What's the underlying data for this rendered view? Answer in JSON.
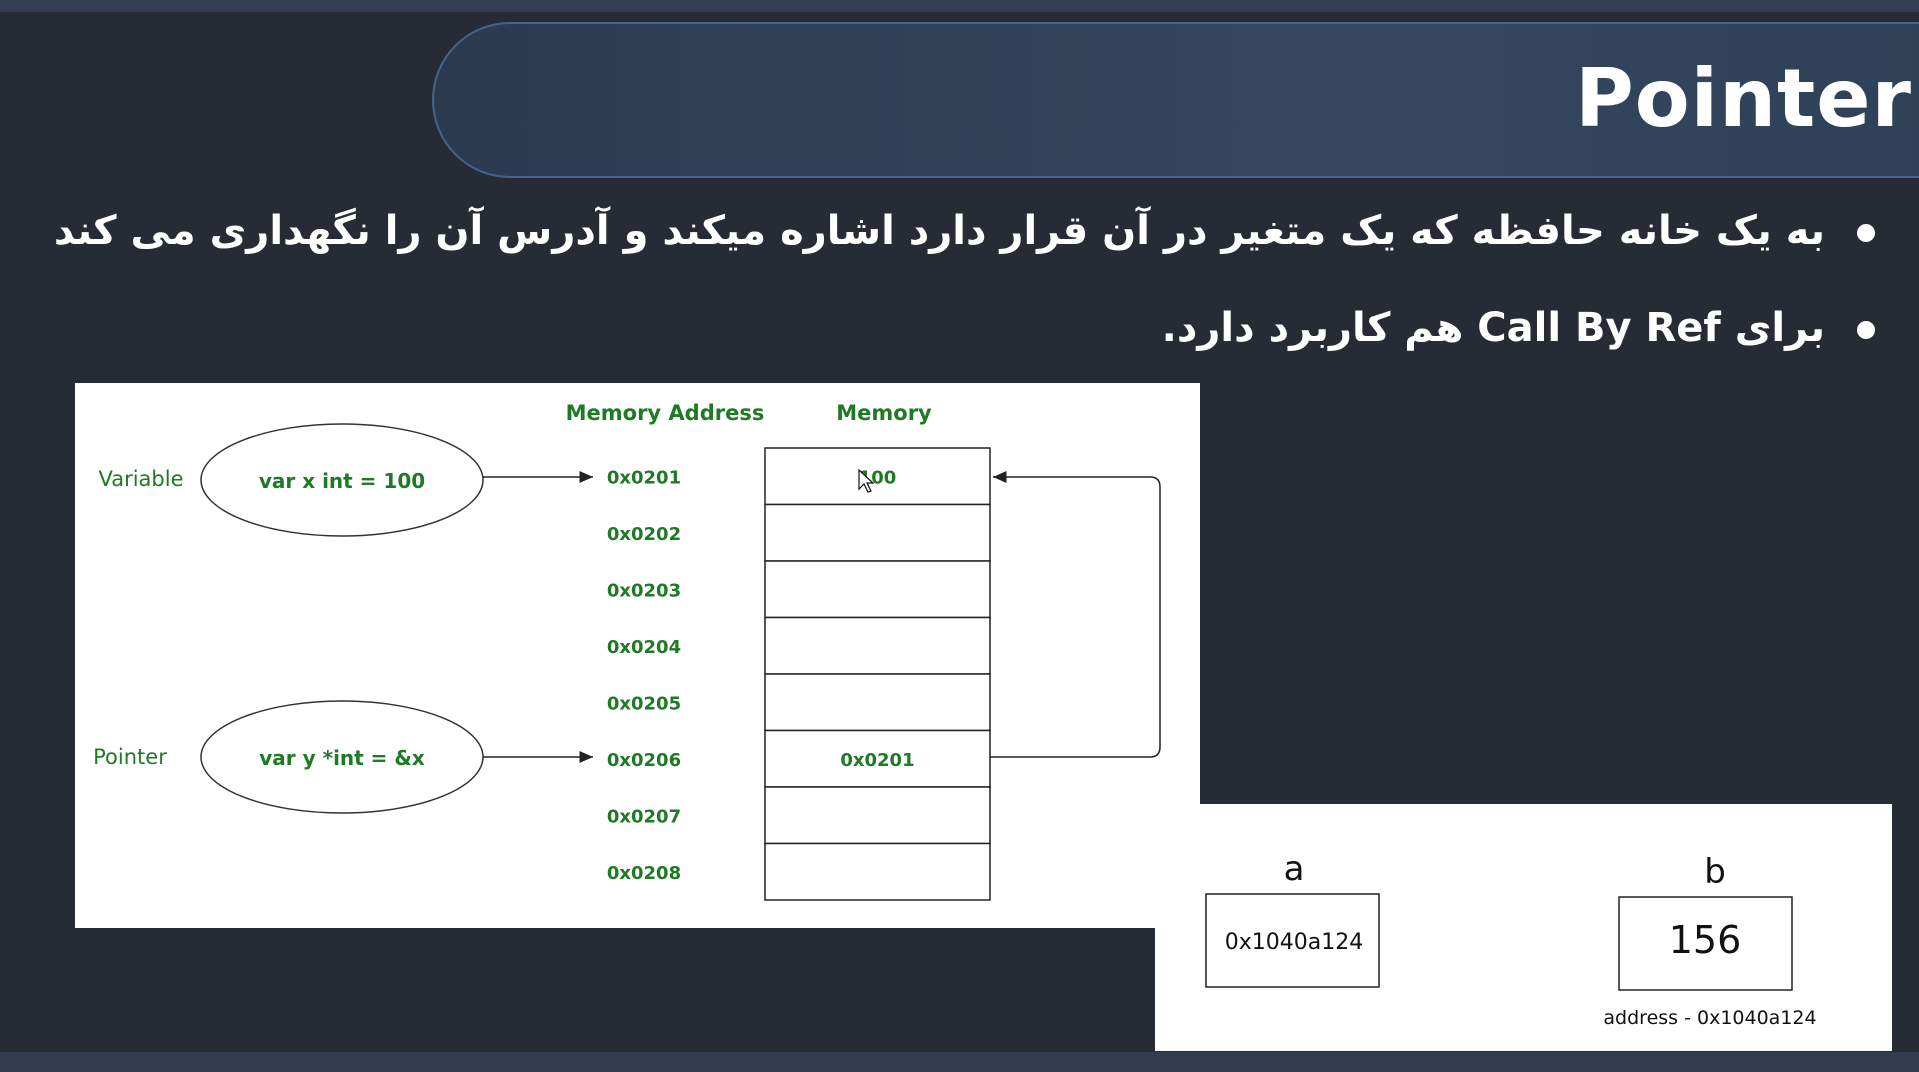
{
  "slide": {
    "title": "Pointer",
    "bullets": [
      "به یک خانه حافظه که یک متغیر در آن قرار دارد اشاره میکند و آدرس آن را نگهداری می کند",
      "برای Call By Ref هم کاربرد دارد."
    ]
  },
  "diagram1": {
    "header_address": "Memory Address",
    "header_memory": "Memory",
    "variable_label": "Variable",
    "variable_decl": "var x int = 100",
    "pointer_label": "Pointer",
    "pointer_decl": "var y *int = &x",
    "addresses": [
      "0x0201",
      "0x0202",
      "0x0203",
      "0x0204",
      "0x0205",
      "0x0206",
      "0x0207",
      "0x0208"
    ],
    "cells": [
      "100",
      "",
      "",
      "",
      "",
      "0x0201",
      "",
      ""
    ],
    "green": "#1e7a24"
  },
  "diagram2": {
    "var_a_name": "a",
    "var_a_value": "0x1040a124",
    "var_b_name": "b",
    "var_b_value": "156",
    "var_b_address": "address - 0x1040a124"
  }
}
